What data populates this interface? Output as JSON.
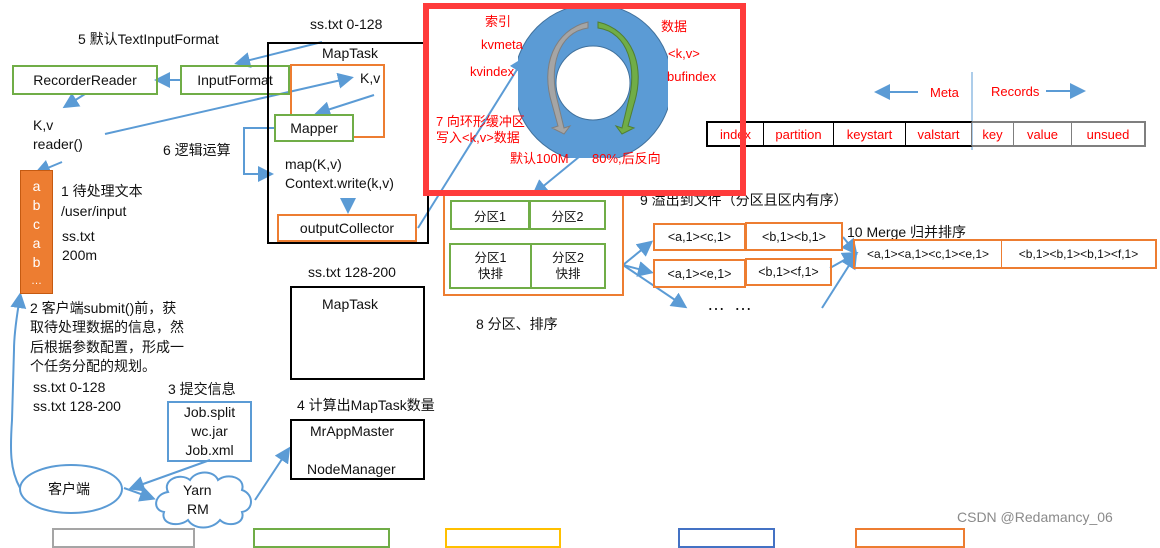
{
  "labels": {
    "step5": "5 默认TextInputFormat",
    "step6": "6 逻辑运算",
    "step1_title": "1 待处理文本",
    "step1_path": "/user/input",
    "step1_file": "ss.txt",
    "step1_size": "200m",
    "step2_lines": [
      "2 客户端submit()前，获",
      "取待处理数据的信息，然",
      "后根据参数配置，形成一",
      "个任务分配的规划。"
    ],
    "split1": "ss.txt  0-128",
    "split2": "ss.txt  128-200",
    "step3": "3 提交信息",
    "step4": "4 计算出MapTask数量",
    "step8": "8 分区、排序",
    "step9": "9 溢出到文件（分区且区内有序）",
    "step10": "10 Merge 归并排序",
    "kv_reader_1": "K,v",
    "kv_reader_2": "reader()",
    "maptask1_title": "ss.txt 0-128",
    "maptask2_title": "ss.txt 128-200",
    "ellipsis": "… …",
    "watermark": "CSDN @Redamancy_06"
  },
  "stack_chars": [
    "a",
    "b",
    "c",
    "a",
    "b",
    "…"
  ],
  "boxes": {
    "recorder_reader": "RecorderReader",
    "input_format": "InputFormat",
    "maptask1": "MapTask",
    "kv": "K,v",
    "mapper": "Mapper",
    "map_call": "map(K,v)",
    "context_write": "Context.write(k,v)",
    "output_collector": "outputCollector",
    "maptask2": "MapTask",
    "job_files": [
      "Job.split",
      "wc.jar",
      "Job.xml"
    ],
    "mr_app_master": "MrAppMaster",
    "node_manager": "NodeManager",
    "client": "客户端",
    "yarn": "Yarn",
    "rm": "RM"
  },
  "ring_buffer": {
    "index_label": "索引",
    "kvmeta": "kvmeta",
    "kvindex": "kvindex",
    "data_label": "数据",
    "kv": "<k,v>",
    "bufindex": "bufindex",
    "step7_line1": "7 向环形缓冲区",
    "step7_line2": "写入<k,v>数据",
    "default_size": "默认100M",
    "reverse": "80%,后反向"
  },
  "meta_records": {
    "meta_label": "Meta",
    "records_label": "Records",
    "cells": [
      "index",
      "partition",
      "keystart",
      "valstart",
      "key",
      "value",
      "unsued"
    ]
  },
  "partitions": {
    "row1": [
      "分区1",
      "分区2"
    ],
    "row2": [
      [
        "分区1",
        "快排"
      ],
      [
        "分区2",
        "快排"
      ]
    ]
  },
  "spill_files": [
    [
      "<a,1><c,1>",
      "<b,1><b,1>"
    ],
    [
      "<a,1><e,1>",
      "<b,1><f,1>"
    ]
  ],
  "merged": [
    "<a,1><a,1><c,1><e,1>",
    "<b,1><b,1><b,1><f,1>"
  ],
  "colors": {
    "highlight_frame": "#ff3b3b",
    "arrow": "#5b9bd5",
    "green": "#70ad47",
    "orange": "#ed7d31",
    "ring": "#5b9bd5"
  }
}
